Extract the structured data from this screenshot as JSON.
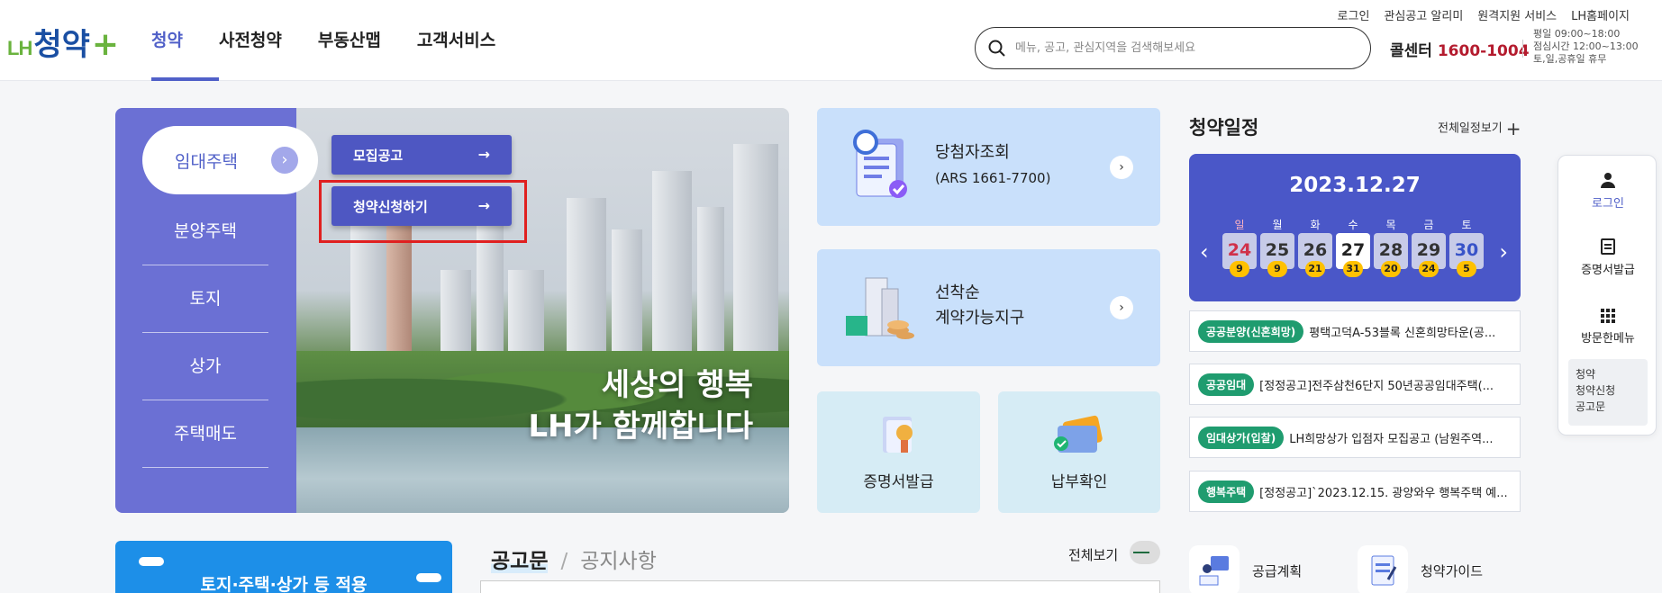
{
  "logo": {
    "lh": "LH",
    "main": "청약",
    "plus": "+"
  },
  "gnb": [
    {
      "label": "청약",
      "active": true
    },
    {
      "label": "사전청약",
      "active": false
    },
    {
      "label": "부동산맵",
      "active": false
    },
    {
      "label": "고객서비스",
      "active": false
    }
  ],
  "util": [
    "로그인",
    "관심공고 알리미",
    "원격지원 서비스",
    "LH홈페이지"
  ],
  "search": {
    "placeholder": "메뉴, 공고, 관심지역을 검색해보세요"
  },
  "call_center": {
    "label": "콜센터",
    "number": "1600-1004",
    "hours1": "평일 09:00~18:00",
    "hours2": "점심시간 12:00~13:00",
    "hours3": "토,일,공휴일 휴무"
  },
  "sidenav": {
    "active": "임대주택",
    "active_arrow": "›",
    "items": [
      "분양주택",
      "토지",
      "상가",
      "주택매도"
    ]
  },
  "submenu": [
    {
      "label": "모집공고",
      "arrow": "→"
    },
    {
      "label": "청약신청하기",
      "arrow": "→"
    }
  ],
  "hero_text": {
    "line1": "세상의 행복",
    "line2": "LH가 함께합니다"
  },
  "cards": {
    "winner": {
      "title": "당첨자조회",
      "sub": "(ARS 1661-7700)",
      "arrow": "›"
    },
    "first_come": {
      "line1": "선착순",
      "line2": "계약가능지구",
      "arrow": "›"
    },
    "certificate": "증명서발급",
    "payment": "납부확인"
  },
  "schedule": {
    "title": "청약일정",
    "view_all": "전체일정보기",
    "plus": "+",
    "date": "2023.12.27",
    "prev": "‹",
    "next": "›",
    "days": [
      {
        "dow": "일",
        "num": "24",
        "count": "9",
        "kind": "sun"
      },
      {
        "dow": "월",
        "num": "25",
        "count": "9",
        "kind": ""
      },
      {
        "dow": "화",
        "num": "26",
        "count": "21",
        "kind": ""
      },
      {
        "dow": "수",
        "num": "27",
        "count": "31",
        "kind": "sel"
      },
      {
        "dow": "목",
        "num": "28",
        "count": "20",
        "kind": ""
      },
      {
        "dow": "금",
        "num": "29",
        "count": "24",
        "kind": ""
      },
      {
        "dow": "토",
        "num": "30",
        "count": "5",
        "kind": "sat"
      }
    ],
    "news": [
      {
        "tag": "공공분양(신혼희망)",
        "text": "평택고덕A-53블록 신혼희망타운(공..."
      },
      {
        "tag": "공공임대",
        "text": "[정정공고]전주삼천6단지 50년공공임대주택(..."
      },
      {
        "tag": "임대상가(입찰)",
        "text": "LH희망상가 입점자 모집공고 (남원주역..."
      },
      {
        "tag": "행복주택",
        "text": "[정정공고]`2023.12.15. 광양와우 행복주택 예..."
      }
    ]
  },
  "promo": {
    "text": "토지·주택·상가 등 적용"
  },
  "board": {
    "tab_active": "공고문",
    "tab_sep": "/",
    "tab_inactive": "공지사항",
    "view_all": "전체보기"
  },
  "quick_bottom": [
    "공급계획",
    "청약가이드"
  ],
  "float_panel": {
    "login": "로그인",
    "certificate": "증명서발급",
    "visited": "방문한메뉴",
    "recent": [
      "청약",
      "청약신청",
      "공고문"
    ]
  },
  "colors": {
    "accent": "#5060c8",
    "side_purple": "#6b70d4",
    "calendar": "#4a57c8",
    "tag_green": "#1f9c6f",
    "highlight": "#e02020"
  }
}
